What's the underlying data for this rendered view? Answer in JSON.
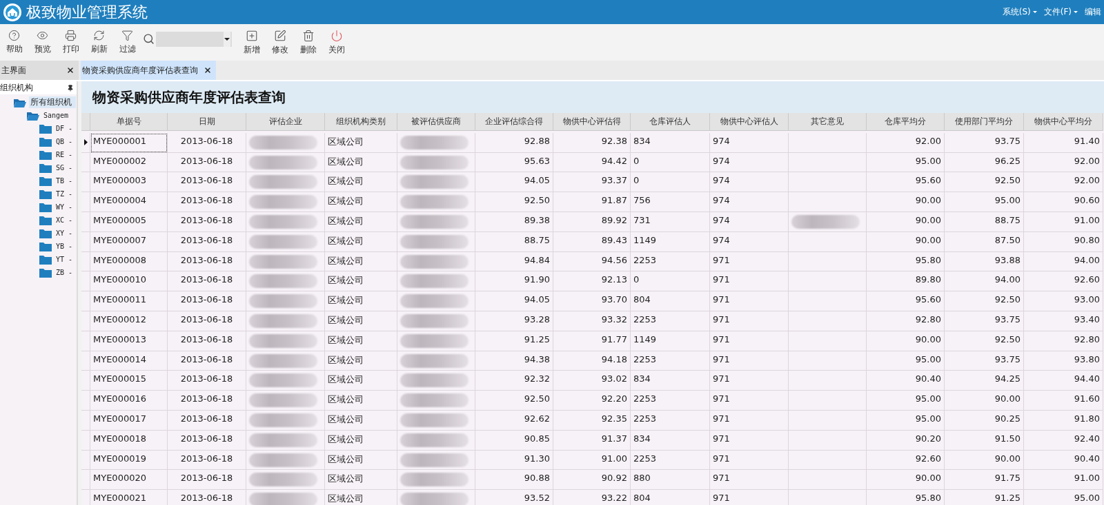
{
  "app": {
    "title": "极致物业管理系统",
    "menu": [
      {
        "label": "系统(S)",
        "kind": "dropdown"
      },
      {
        "label": "文件(F)",
        "kind": "dropdown"
      },
      {
        "label": "编辑",
        "kind": "plain"
      }
    ]
  },
  "toolbar": {
    "left_buttons": [
      {
        "label": "帮助"
      },
      {
        "label": "预览"
      },
      {
        "label": "打印"
      },
      {
        "label": "刷新"
      },
      {
        "label": "过滤"
      }
    ],
    "right_buttons": [
      {
        "label": "新增"
      },
      {
        "label": "修改"
      },
      {
        "label": "删除"
      },
      {
        "label": "关闭"
      }
    ]
  },
  "tabs": [
    {
      "label": "主界面",
      "selected": false
    },
    {
      "label": "物资采购供应商年度评估表查询",
      "selected": true
    }
  ],
  "sidebar": {
    "title": "组织机构",
    "tree": [
      {
        "label": "所有组织机",
        "selected": true,
        "expanded": true,
        "children": [
          {
            "label": "Sangem",
            "selected": false,
            "expanded": true,
            "children": [
              {
                "label": "DF -",
                "selected": false,
                "expanded": false
              },
              {
                "label": "QB -",
                "selected": false,
                "expanded": false
              },
              {
                "label": "RE -",
                "selected": false,
                "expanded": false
              },
              {
                "label": "SG -",
                "selected": false,
                "expanded": false
              },
              {
                "label": "TB -",
                "selected": false,
                "expanded": false
              },
              {
                "label": "TZ -",
                "selected": false,
                "expanded": false
              },
              {
                "label": "WY -",
                "selected": false,
                "expanded": false
              },
              {
                "label": "XC -",
                "selected": false,
                "expanded": false
              },
              {
                "label": "XY -",
                "selected": false,
                "expanded": false
              },
              {
                "label": "YB -",
                "selected": false,
                "expanded": false
              },
              {
                "label": "YT -",
                "selected": false,
                "expanded": false
              },
              {
                "label": "ZB -",
                "selected": false,
                "expanded": false
              }
            ]
          }
        ]
      }
    ]
  },
  "page_title": "物资采购供应商年度评估表查询",
  "table": {
    "columns": [
      {
        "label": "单据号",
        "kind": "text"
      },
      {
        "label": "日期",
        "kind": "date"
      },
      {
        "label": "评估企业"
      },
      {
        "label": "组织机构类别",
        "kind": "text"
      },
      {
        "label": "被评估供应商"
      },
      {
        "label": "企业评估综合得",
        "kind": "number"
      },
      {
        "label": "物供中心评估得",
        "kind": "number"
      },
      {
        "label": "仓库评估人",
        "kind": "text"
      },
      {
        "label": "物供中心评估人",
        "kind": "text"
      },
      {
        "label": "其它意见"
      },
      {
        "label": "仓库平均分",
        "kind": "number"
      },
      {
        "label": "使用部门平均分",
        "kind": "number"
      },
      {
        "label": "物供中心平均分",
        "kind": "number"
      }
    ],
    "rows": [
      {
        "selected": true,
        "cells": [
          "MYE000001",
          "2013-06-18",
          {
            "kind": "blurred"
          },
          "区域公司",
          {
            "kind": "blurred"
          },
          "92.88",
          "92.38",
          "834",
          "974",
          {
            "kind": "blank"
          },
          "92.00",
          "93.75",
          "91.40"
        ]
      },
      {
        "selected": false,
        "cells": [
          "MYE000002",
          "2013-06-18",
          {
            "kind": "blurred"
          },
          "区域公司",
          {
            "kind": "blurred"
          },
          "95.63",
          "94.42",
          "0",
          "974",
          {
            "kind": "blank"
          },
          "95.00",
          "96.25",
          "92.00"
        ]
      },
      {
        "selected": false,
        "cells": [
          "MYE000003",
          "2013-06-18",
          {
            "kind": "blurred"
          },
          "区域公司",
          {
            "kind": "blurred"
          },
          "94.05",
          "93.37",
          "0",
          "974",
          {
            "kind": "blank"
          },
          "95.60",
          "92.50",
          "92.00"
        ]
      },
      {
        "selected": false,
        "cells": [
          "MYE000004",
          "2013-06-18",
          {
            "kind": "blurred"
          },
          "区域公司",
          {
            "kind": "blurred"
          },
          "92.50",
          "91.87",
          "756",
          "974",
          {
            "kind": "blank"
          },
          "90.00",
          "95.00",
          "90.60"
        ]
      },
      {
        "selected": false,
        "cells": [
          "MYE000005",
          "2013-06-18",
          {
            "kind": "blurred"
          },
          "区域公司",
          {
            "kind": "blurred"
          },
          "89.38",
          "89.92",
          "731",
          "974",
          {
            "kind": "blurred"
          },
          "90.00",
          "88.75",
          "91.00"
        ]
      },
      {
        "selected": false,
        "cells": [
          "MYE000007",
          "2013-06-18",
          {
            "kind": "blurred"
          },
          "区域公司",
          {
            "kind": "blurred"
          },
          "88.75",
          "89.43",
          "1149",
          "974",
          {
            "kind": "blank"
          },
          "90.00",
          "87.50",
          "90.80"
        ]
      },
      {
        "selected": false,
        "cells": [
          "MYE000008",
          "2013-06-18",
          {
            "kind": "blurred"
          },
          "区域公司",
          {
            "kind": "blurred"
          },
          "94.84",
          "94.56",
          "2253",
          "971",
          {
            "kind": "blank"
          },
          "95.80",
          "93.88",
          "94.00"
        ]
      },
      {
        "selected": false,
        "cells": [
          "MYE000010",
          "2013-06-18",
          {
            "kind": "blurred"
          },
          "区域公司",
          {
            "kind": "blurred"
          },
          "91.90",
          "92.13",
          "0",
          "971",
          {
            "kind": "blank"
          },
          "89.80",
          "94.00",
          "92.60"
        ]
      },
      {
        "selected": false,
        "cells": [
          "MYE000011",
          "2013-06-18",
          {
            "kind": "blurred"
          },
          "区域公司",
          {
            "kind": "blurred"
          },
          "94.05",
          "93.70",
          "804",
          "971",
          {
            "kind": "blank"
          },
          "95.60",
          "92.50",
          "93.00"
        ]
      },
      {
        "selected": false,
        "cells": [
          "MYE000012",
          "2013-06-18",
          {
            "kind": "blurred"
          },
          "区域公司",
          {
            "kind": "blurred"
          },
          "93.28",
          "93.32",
          "2253",
          "971",
          {
            "kind": "blank"
          },
          "92.80",
          "93.75",
          "93.40"
        ]
      },
      {
        "selected": false,
        "cells": [
          "MYE000013",
          "2013-06-18",
          {
            "kind": "blurred"
          },
          "区域公司",
          {
            "kind": "blurred"
          },
          "91.25",
          "91.77",
          "1149",
          "971",
          {
            "kind": "blank"
          },
          "90.00",
          "92.50",
          "92.80"
        ]
      },
      {
        "selected": false,
        "cells": [
          "MYE000014",
          "2013-06-18",
          {
            "kind": "blurred"
          },
          "区域公司",
          {
            "kind": "blurred"
          },
          "94.38",
          "94.18",
          "2253",
          "971",
          {
            "kind": "blank"
          },
          "95.00",
          "93.75",
          "93.80"
        ]
      },
      {
        "selected": false,
        "cells": [
          "MYE000015",
          "2013-06-18",
          {
            "kind": "blurred"
          },
          "区域公司",
          {
            "kind": "blurred"
          },
          "92.32",
          "93.02",
          "834",
          "971",
          {
            "kind": "blank"
          },
          "90.40",
          "94.25",
          "94.40"
        ]
      },
      {
        "selected": false,
        "cells": [
          "MYE000016",
          "2013-06-18",
          {
            "kind": "blurred"
          },
          "区域公司",
          {
            "kind": "blurred"
          },
          "92.50",
          "92.20",
          "2253",
          "971",
          {
            "kind": "blank"
          },
          "95.00",
          "90.00",
          "91.60"
        ]
      },
      {
        "selected": false,
        "cells": [
          "MYE000017",
          "2013-06-18",
          {
            "kind": "blurred"
          },
          "区域公司",
          {
            "kind": "blurred"
          },
          "92.62",
          "92.35",
          "2253",
          "971",
          {
            "kind": "blank"
          },
          "95.00",
          "90.25",
          "91.80"
        ]
      },
      {
        "selected": false,
        "cells": [
          "MYE000018",
          "2013-06-18",
          {
            "kind": "blurred"
          },
          "区域公司",
          {
            "kind": "blurred"
          },
          "90.85",
          "91.37",
          "834",
          "971",
          {
            "kind": "blank"
          },
          "90.20",
          "91.50",
          "92.40"
        ]
      },
      {
        "selected": false,
        "cells": [
          "MYE000019",
          "2013-06-18",
          {
            "kind": "blurred"
          },
          "区域公司",
          {
            "kind": "blurred"
          },
          "91.30",
          "91.00",
          "2253",
          "971",
          {
            "kind": "blank"
          },
          "92.60",
          "90.00",
          "90.40"
        ]
      },
      {
        "selected": false,
        "cells": [
          "MYE000020",
          "2013-06-18",
          {
            "kind": "blurred"
          },
          "区域公司",
          {
            "kind": "blurred"
          },
          "90.88",
          "90.92",
          "880",
          "971",
          {
            "kind": "blank"
          },
          "90.00",
          "91.75",
          "91.00"
        ]
      },
      {
        "selected": false,
        "cells": [
          "MYE000021",
          "2013-06-18",
          {
            "kind": "blurred"
          },
          "区域公司",
          {
            "kind": "blurred"
          },
          "93.52",
          "93.22",
          "804",
          "971",
          {
            "kind": "blank"
          },
          "95.80",
          "91.25",
          "95.00"
        ]
      }
    ]
  }
}
